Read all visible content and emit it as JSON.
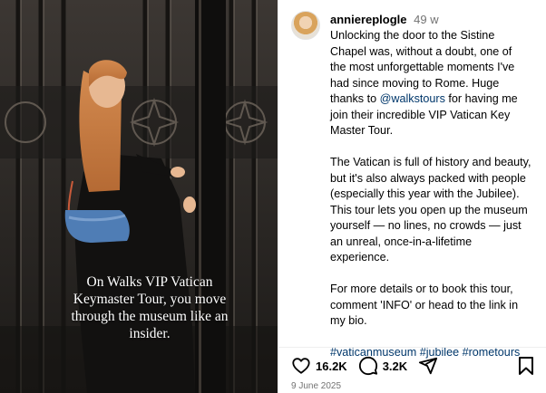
{
  "media": {
    "overlay_lines": [
      "On Walks VIP Vatican",
      "Keymaster Tour, you move",
      "through the museum like an",
      "insider."
    ]
  },
  "post": {
    "username": "anniereplogle",
    "time": "49 w",
    "caption": {
      "p1_line1": "Unlocking the door to the Sistine",
      "p1_line2": "Chapel was, without a doubt, one of",
      "p1_line3": "the most unforgettable moments I've",
      "p1_line4": "had since moving to Rome. Huge",
      "p1_line5_pre": "thanks to ",
      "mention": "@walkstours",
      "p1_line5_post": " for having me",
      "p1_line6": "join their incredible VIP Vatican Key",
      "p1_line7": "Master Tour.",
      "p2_line1": "The Vatican is full of history and beauty,",
      "p2_line2": "but it's also always packed with people",
      "p2_line3": "(especially this year with the Jubilee).",
      "p2_line4": "This tour lets you open up the museum",
      "p2_line5": "yourself — no lines, no crowds — just",
      "p2_line6": "an unreal, once-in-a-lifetime",
      "p2_line7": "experience.",
      "p3_line1": "For more details or to book this tour,",
      "p3_line2": "comment 'INFO' or head to the link in",
      "p3_line3": "my bio.",
      "hashtags": "#vaticanmuseum #jubilee #rometours"
    },
    "likes": "16.2K",
    "comments": "3.2K",
    "date": "9 June 2025",
    "icons": {
      "like": "heart-icon",
      "comment": "comment-icon",
      "share": "share-icon",
      "save": "bookmark-icon"
    }
  }
}
